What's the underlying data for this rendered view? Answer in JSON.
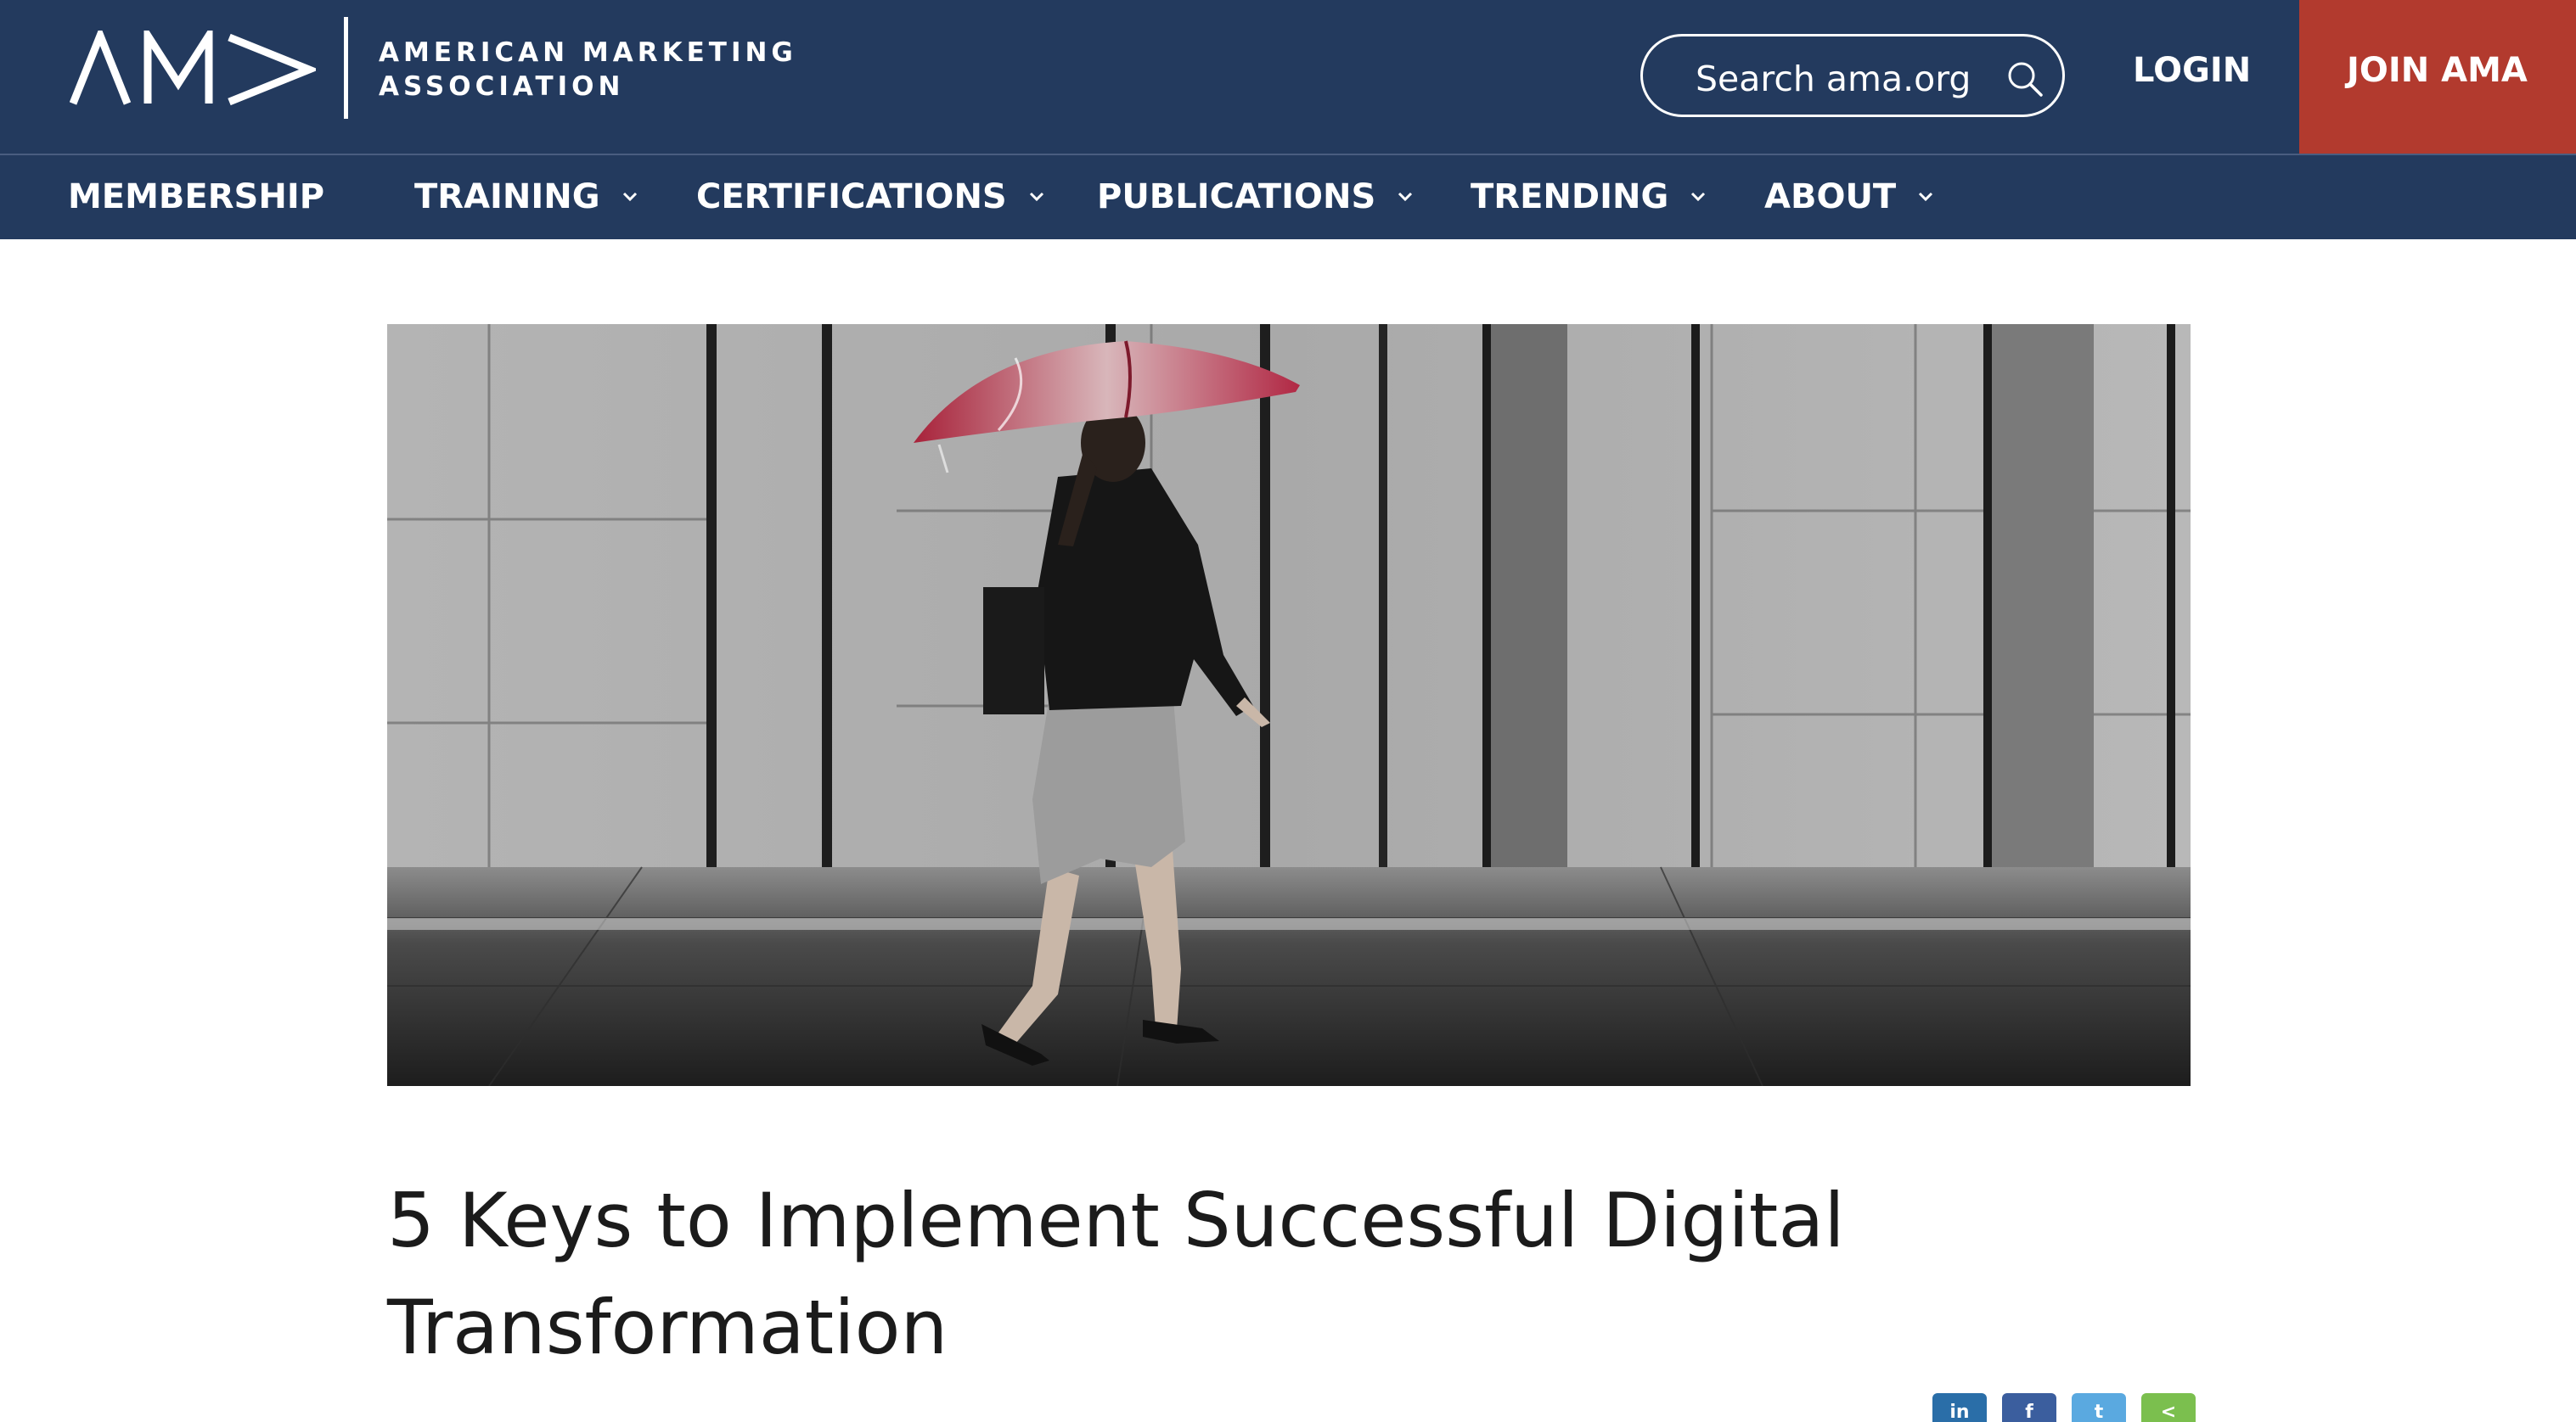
{
  "header": {
    "logo_line1": "AMERICAN MARKETING",
    "logo_line2": "ASSOCIATION",
    "search_placeholder": "Search ama.org",
    "login_label": "LOGIN",
    "join_label": "JOIN AMA"
  },
  "nav": {
    "items": [
      {
        "label": "MEMBERSHIP",
        "has_dropdown": false
      },
      {
        "label": "TRAINING",
        "has_dropdown": true
      },
      {
        "label": "CERTIFICATIONS",
        "has_dropdown": true
      },
      {
        "label": "PUBLICATIONS",
        "has_dropdown": true
      },
      {
        "label": "TRENDING",
        "has_dropdown": true
      },
      {
        "label": "ABOUT",
        "has_dropdown": true
      }
    ]
  },
  "article": {
    "title_line1": "5 Keys to Implement Successful Digital",
    "title_line2": "Transformation"
  },
  "share": {
    "icons": [
      {
        "name": "linkedin-icon",
        "glyph": "in",
        "color": "#2a6ea8"
      },
      {
        "name": "facebook-icon",
        "glyph": "f",
        "color": "#3b5e9e"
      },
      {
        "name": "twitter-icon",
        "glyph": "t",
        "color": "#5aa9e0"
      },
      {
        "name": "share-icon",
        "glyph": "<",
        "color": "#7bbf4e"
      }
    ]
  },
  "colors": {
    "header_bg": "#233a5e",
    "join_bg": "#b23a2e",
    "title_text": "#1b1b1b"
  }
}
